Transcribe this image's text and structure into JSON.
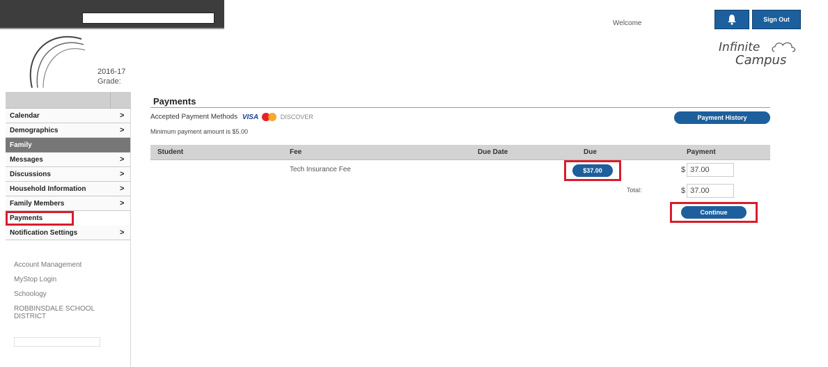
{
  "header": {
    "school_year": "2016-17",
    "grade_label": "Grade:",
    "welcome": "Welcome",
    "sign_out": "Sign Out",
    "bell_icon": "bell-icon",
    "brand_line1": "Infinite",
    "brand_line2": "Campus"
  },
  "sidebar": {
    "items": [
      {
        "label": "Calendar",
        "chevron": ">"
      },
      {
        "label": "Demographics",
        "chevron": ">"
      }
    ],
    "section_family": "Family",
    "family_items": [
      {
        "label": "Messages",
        "chevron": ">"
      },
      {
        "label": "Discussions",
        "chevron": ">"
      },
      {
        "label": "Household Information",
        "chevron": ">"
      },
      {
        "label": "Family Members",
        "chevron": ">"
      },
      {
        "label": "Payments",
        "chevron": ""
      },
      {
        "label": "Notification Settings",
        "chevron": ">"
      }
    ],
    "links": [
      "Account Management",
      "MyStop Login",
      "Schoology",
      "ROBBINSDALE SCHOOL DISTRICT"
    ]
  },
  "main": {
    "title": "Payments",
    "accepted_label": "Accepted Payment Methods",
    "visa": "VISA",
    "discover": "DISCOVER",
    "minimum": "Minimum payment amount is $5.00",
    "payment_history": "Payment History",
    "columns": [
      "Student",
      "Fee",
      "Due Date",
      "Due",
      "Payment"
    ],
    "rows": [
      {
        "student": "",
        "fee": "Tech Insurance Fee",
        "due_date": "",
        "due": "$37.00",
        "currency": "$",
        "payment": "37.00"
      }
    ],
    "total_label": "Total:",
    "total_currency": "$",
    "total_value": "37.00",
    "continue": "Continue"
  },
  "colors": {
    "accent_blue": "#1d5f9c",
    "highlight_red": "#d81d2a",
    "header_dark": "#3d3d3d"
  }
}
